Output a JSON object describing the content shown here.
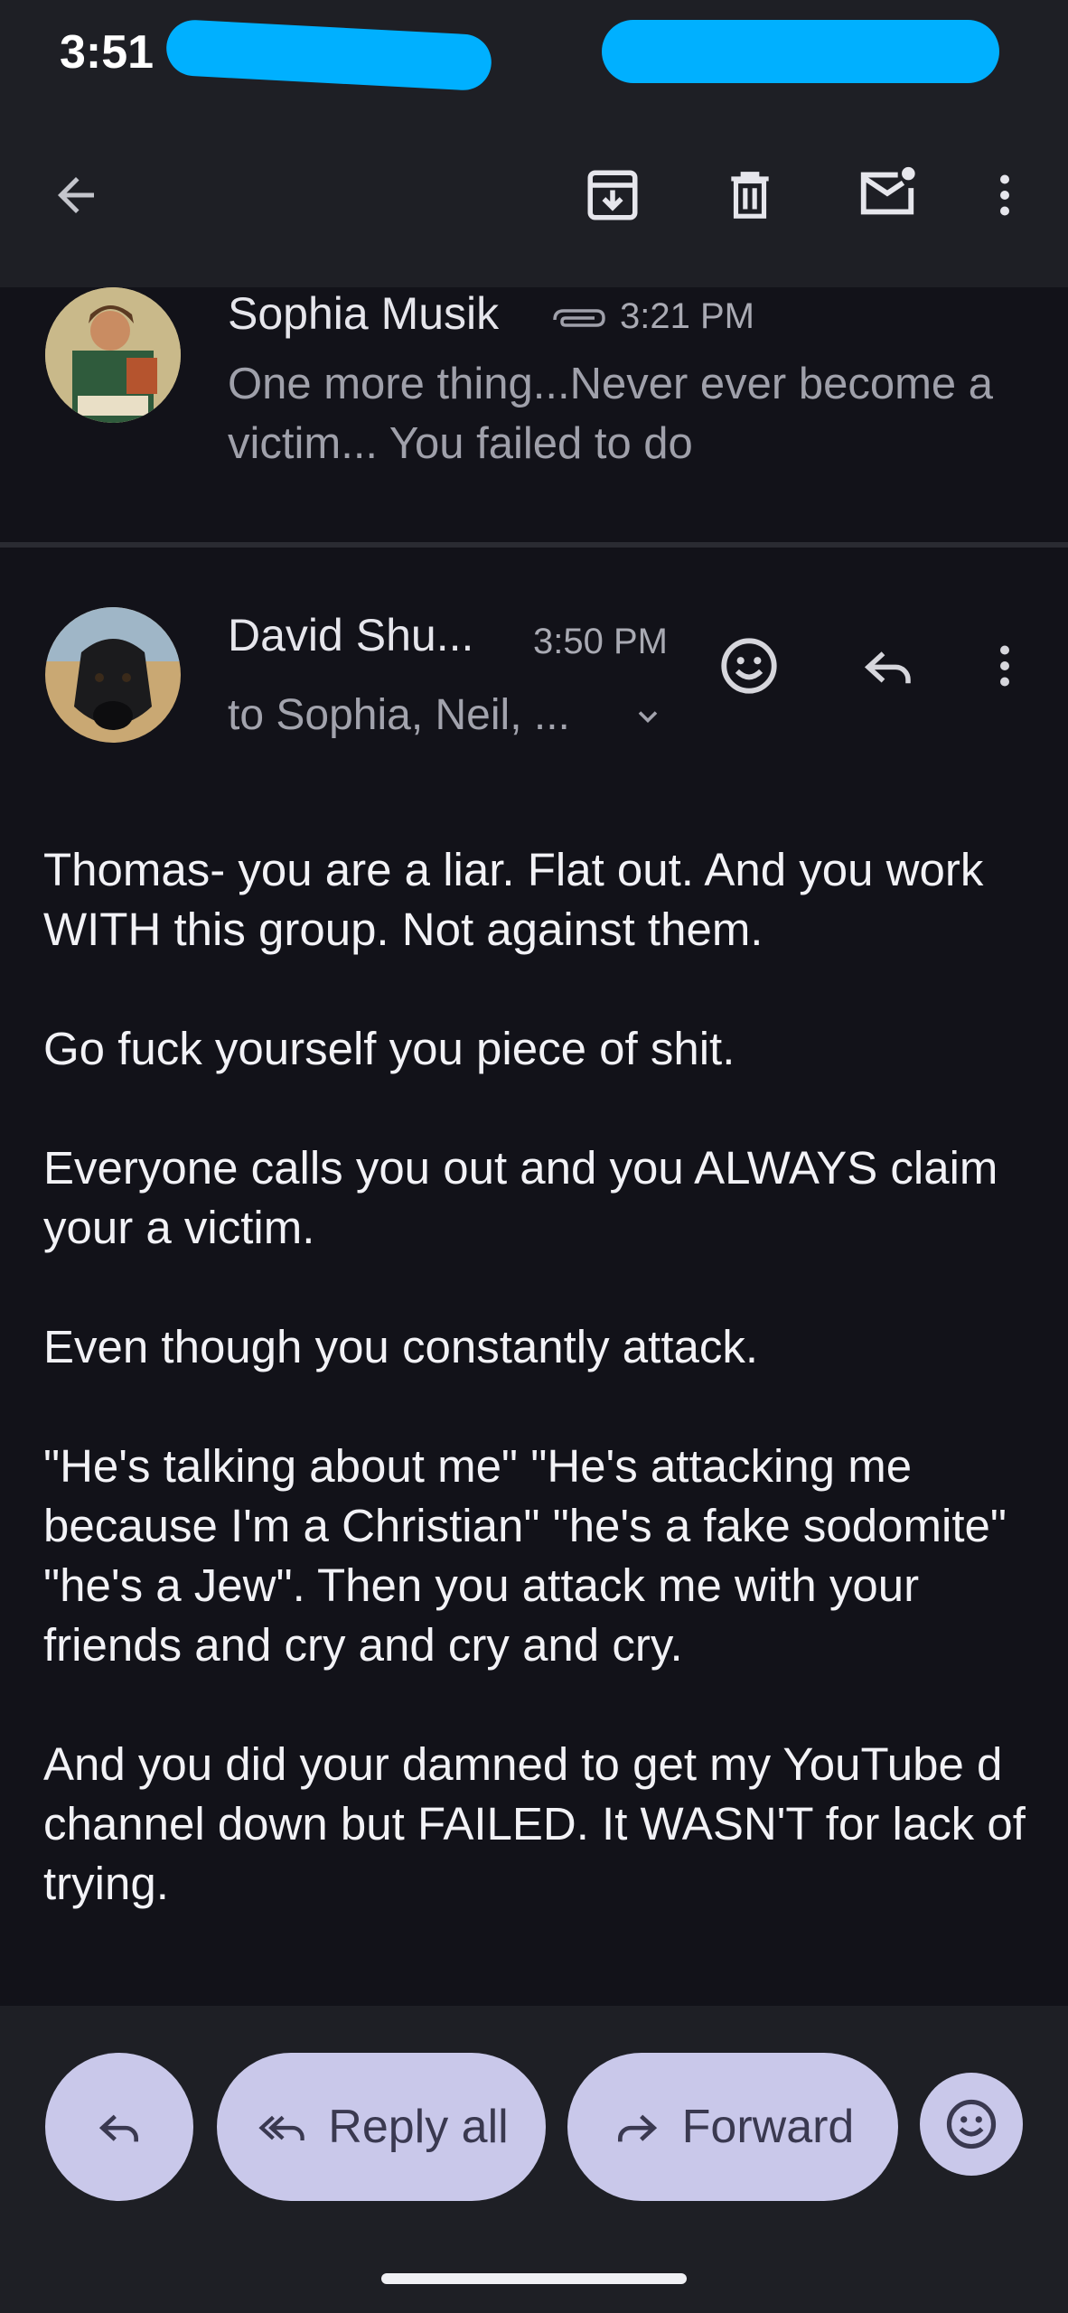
{
  "status_bar": {
    "time": "3:51"
  },
  "toolbar": {
    "back_icon": "arrow-left-icon",
    "archive_icon": "archive-icon",
    "delete_icon": "trash-icon",
    "mark_unread_icon": "mail-unread-icon",
    "more_icon": "more-vert-icon"
  },
  "messages": [
    {
      "sender": "Sophia Musik",
      "attachment_icon": "paperclip-icon",
      "time": "3:21 PM",
      "snippet": "One more thing...Never ever become a victim... You failed to do"
    },
    {
      "sender": "David Shu...",
      "time": "3:50 PM",
      "recipients": "to Sophia, Neil, ...",
      "body": [
        "Thomas- you are a liar. Flat out. And you work WITH this group. Not against them.",
        "Go fuck yourself you piece of shit.",
        "Everyone calls you out and you ALWAYS claim your a victim.",
        "Even though you constantly attack.",
        "\"He's talking about me\" \"He's attacking me because I'm a Christian\" \"he's a fake sodomite\" \"he's a Jew\". Then you attack me with your friends and cry and cry and cry.",
        "And you did your damned to get my YouTube d channel down but FAILED. It WASN'T for lack of trying."
      ]
    }
  ],
  "actions": {
    "reply_icon": "reply-icon",
    "reply_all_label": "Reply all",
    "forward_label": "Forward",
    "emoji_icon": "emoji-icon"
  },
  "colors": {
    "background": "#121219",
    "bar": "#1e1f25",
    "pill": "#c9c8ea",
    "redaction": "#00b0ff"
  }
}
